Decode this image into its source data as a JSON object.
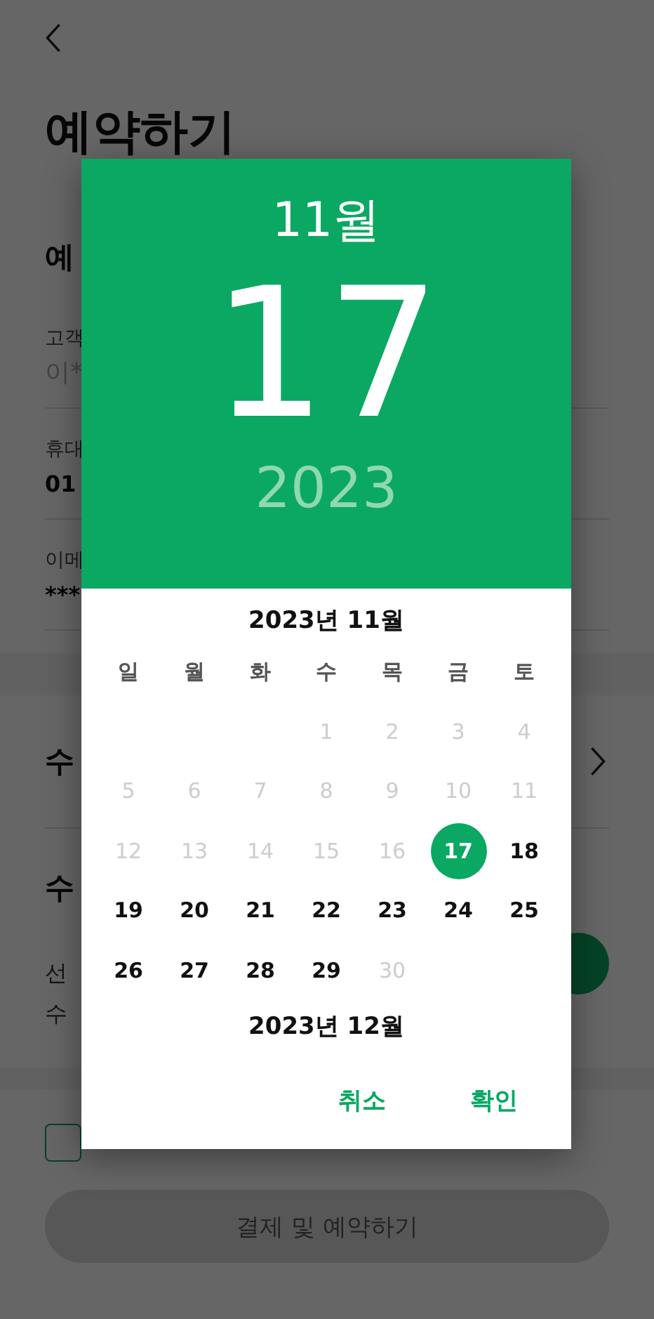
{
  "title": "예약하기",
  "reservation_section": {
    "heading": "예",
    "fields": [
      {
        "label": "고객",
        "value": "이*",
        "kind": "muted"
      },
      {
        "label": "휴대",
        "value": "01",
        "kind": "strong"
      },
      {
        "label": "이메",
        "value": "***",
        "kind": "strong"
      }
    ]
  },
  "link_row": {
    "heading": "수"
  },
  "quantity_section": {
    "heading": "수",
    "lines": [
      "선",
      "수"
    ]
  },
  "agreement_checkbox": {
    "checked": false
  },
  "submit_button": {
    "label": "결제 및 예약하기",
    "disabled": true
  },
  "date_picker": {
    "header_month": "11월",
    "header_day": "17",
    "header_year": "2023",
    "month_title": "2023년 11월",
    "weekdays": [
      "일",
      "월",
      "화",
      "수",
      "목",
      "금",
      "토"
    ],
    "weeks": [
      [
        {
          "day": "1",
          "disabled": true,
          "selected": false
        },
        {
          "day": "2",
          "disabled": true,
          "selected": false
        },
        {
          "day": "3",
          "disabled": true,
          "selected": false
        },
        {
          "day": "4",
          "disabled": true,
          "selected": false
        }
      ],
      [
        {
          "day": "5",
          "disabled": true,
          "selected": false
        },
        {
          "day": "6",
          "disabled": true,
          "selected": false
        },
        {
          "day": "7",
          "disabled": true,
          "selected": false
        },
        {
          "day": "8",
          "disabled": true,
          "selected": false
        },
        {
          "day": "9",
          "disabled": true,
          "selected": false
        },
        {
          "day": "10",
          "disabled": true,
          "selected": false
        },
        {
          "day": "11",
          "disabled": true,
          "selected": false
        }
      ],
      [
        {
          "day": "12",
          "disabled": true,
          "selected": false
        },
        {
          "day": "13",
          "disabled": true,
          "selected": false
        },
        {
          "day": "14",
          "disabled": true,
          "selected": false
        },
        {
          "day": "15",
          "disabled": true,
          "selected": false
        },
        {
          "day": "16",
          "disabled": true,
          "selected": false
        },
        {
          "day": "17",
          "disabled": false,
          "selected": true
        },
        {
          "day": "18",
          "disabled": false,
          "selected": false
        }
      ],
      [
        {
          "day": "19",
          "disabled": false,
          "selected": false
        },
        {
          "day": "20",
          "disabled": false,
          "selected": false
        },
        {
          "day": "21",
          "disabled": false,
          "selected": false
        },
        {
          "day": "22",
          "disabled": false,
          "selected": false
        },
        {
          "day": "23",
          "disabled": false,
          "selected": false
        },
        {
          "day": "24",
          "disabled": false,
          "selected": false
        },
        {
          "day": "25",
          "disabled": false,
          "selected": false
        }
      ],
      [
        {
          "day": "26",
          "disabled": false,
          "selected": false
        },
        {
          "day": "27",
          "disabled": false,
          "selected": false
        },
        {
          "day": "28",
          "disabled": false,
          "selected": false
        },
        {
          "day": "29",
          "disabled": false,
          "selected": false
        },
        {
          "day": "30",
          "disabled": true,
          "selected": false
        }
      ]
    ],
    "next_month_title": "2023년 12월",
    "buttons": [
      "취소",
      "확인"
    ]
  }
}
